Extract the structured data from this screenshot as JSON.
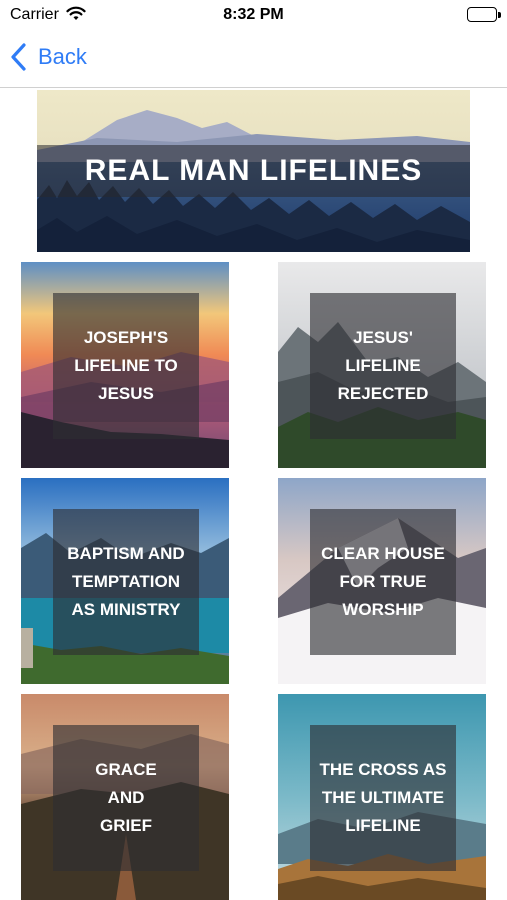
{
  "status": {
    "carrier": "Carrier",
    "time": "8:32 PM"
  },
  "nav": {
    "back_label": "Back"
  },
  "banner": {
    "title": "REAL MAN LIFELINES"
  },
  "tiles": [
    {
      "label": "JOSEPH'S\nLIFELINE TO\nJESUS"
    },
    {
      "label": "JESUS'\nLIFELINE\nREJECTED"
    },
    {
      "label": "BAPTISM AND\nTEMPTATION\nAS MINISTRY"
    },
    {
      "label": "CLEAR HOUSE\nFOR TRUE\nWORSHIP"
    },
    {
      "label": "GRACE\nAND\nGRIEF"
    },
    {
      "label": "THE CROSS AS\nTHE ULTIMATE\nLIFELINE"
    }
  ],
  "icons": {
    "wifi": "wifi-icon",
    "battery": "battery-icon",
    "back": "chevron-left-icon"
  },
  "colors": {
    "accent": "#2f7cf6"
  }
}
